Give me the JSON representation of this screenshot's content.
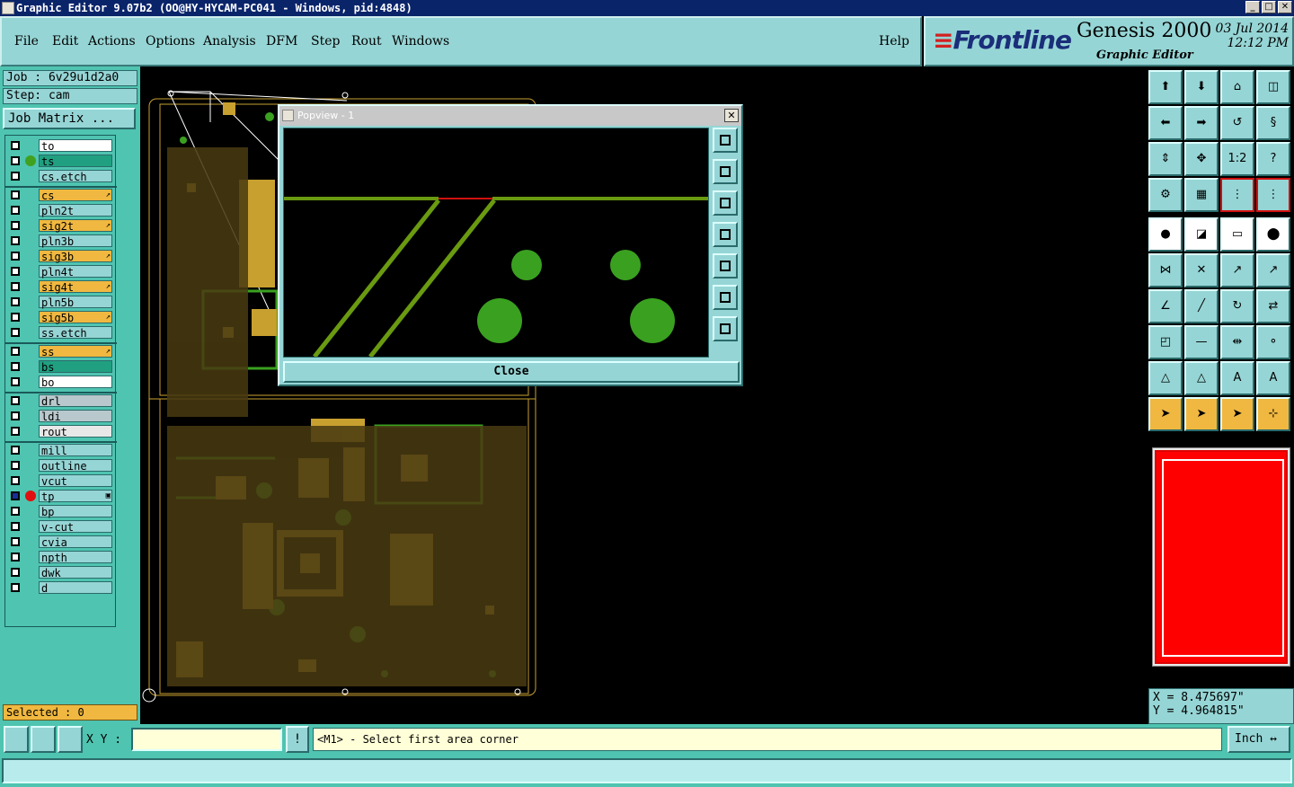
{
  "window": {
    "title": "Graphic Editor 9.07b2 (OO@HY-HYCAM-PC041 - Windows, pid:4848)",
    "buttons": [
      "_",
      "□",
      "✕"
    ]
  },
  "menu": {
    "items": [
      "File",
      "Edit",
      "Actions",
      "Options",
      "Analysis",
      "DFM",
      "Step",
      "Rout",
      "Windows"
    ],
    "help": "Help"
  },
  "brand": {
    "logo": "Frontline",
    "product": "Genesis 2000",
    "subtitle": "Graphic Editor",
    "date": "03 Jul 2014",
    "time": "12:12 PM"
  },
  "job": {
    "job_line": "Job : 6v29u1d2a0",
    "step_line": "Step: cam",
    "matrix_button": "Job Matrix ..."
  },
  "layers": [
    {
      "name": "to",
      "color": "#ffffff"
    },
    {
      "name": "ts",
      "color": "#20a080",
      "dot": "#40a020"
    },
    {
      "name": "cs.etch",
      "color": "#96d5d5"
    },
    {
      "name": "cs",
      "color": "#f0b840",
      "flag": "↗"
    },
    {
      "name": "pln2t",
      "color": "#96d5d5"
    },
    {
      "name": "sig2t",
      "color": "#f0b840",
      "flag": "↗"
    },
    {
      "name": "pln3b",
      "color": "#96d5d5"
    },
    {
      "name": "sig3b",
      "color": "#f0b840",
      "flag": "↗"
    },
    {
      "name": "pln4t",
      "color": "#96d5d5"
    },
    {
      "name": "sig4t",
      "color": "#f0b840",
      "flag": "↗"
    },
    {
      "name": "pln5b",
      "color": "#96d5d5"
    },
    {
      "name": "sig5b",
      "color": "#f0b840",
      "flag": "↗"
    },
    {
      "name": "ss.etch",
      "color": "#96d5d5"
    },
    {
      "name": "ss",
      "color": "#f0b840",
      "flag": "↗"
    },
    {
      "name": "bs",
      "color": "#20a080"
    },
    {
      "name": "bo",
      "color": "#ffffff"
    },
    {
      "name": "drl",
      "color": "#b8c8cc"
    },
    {
      "name": "ldi",
      "color": "#b8c8cc"
    },
    {
      "name": "rout",
      "color": "#e8e8e8"
    },
    {
      "name": "mill",
      "color": "#96d5d5"
    },
    {
      "name": "outline",
      "color": "#96d5d5"
    },
    {
      "name": "vcut",
      "color": "#96d5d5"
    },
    {
      "name": "tp",
      "color": "#96d5d5",
      "dot": "#e01010",
      "flag": "▣"
    },
    {
      "name": "bp",
      "color": "#96d5d5"
    },
    {
      "name": "v-cut",
      "color": "#96d5d5"
    },
    {
      "name": "cvia",
      "color": "#96d5d5"
    },
    {
      "name": "npth",
      "color": "#96d5d5"
    },
    {
      "name": "dwk",
      "color": "#96d5d5"
    },
    {
      "name": "d",
      "color": "#96d5d5"
    }
  ],
  "selected": "Selected : 0",
  "popview": {
    "title": "Popview - 1",
    "close": "Close"
  },
  "coords": {
    "x": "X = 8.475697\"",
    "y": "Y = 4.964815\""
  },
  "bottom": {
    "xy_label": "X Y :",
    "xy_value": "",
    "prompt": "<M1> - Select first area corner",
    "unit": "Inch ↔"
  },
  "tools": {
    "row3_label": "1:2"
  }
}
